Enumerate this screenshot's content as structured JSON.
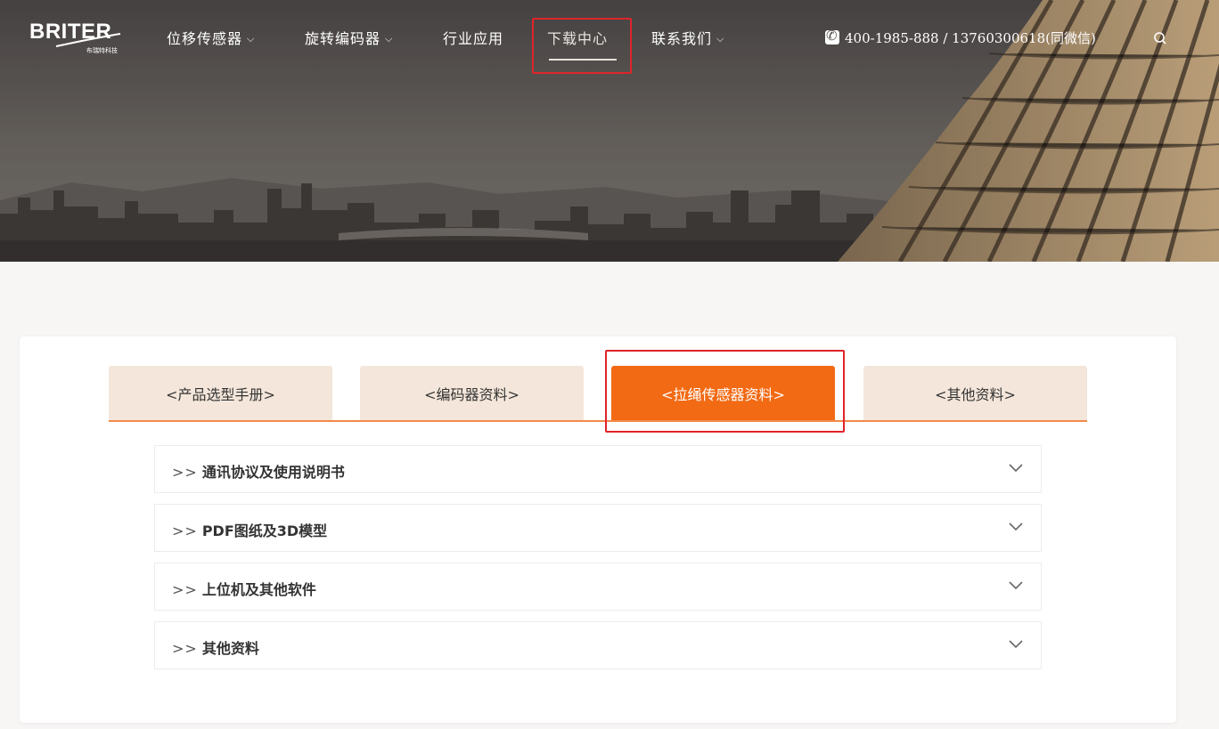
{
  "brand": {
    "logo_text": "BRITER",
    "logo_subtitle": "布瑞特科技"
  },
  "nav": {
    "items": [
      {
        "label": "位移传感器",
        "has_dropdown": true
      },
      {
        "label": "旋转编码器",
        "has_dropdown": true
      },
      {
        "label": "行业应用",
        "has_dropdown": false
      },
      {
        "label": "下载中心",
        "has_dropdown": false,
        "active": true
      },
      {
        "label": "联系我们",
        "has_dropdown": true
      }
    ],
    "dropdown_glyph": "⌵",
    "phone": "400-1985-888 / 13760300618(同微信)",
    "phone_icon": "phone-icon",
    "search_icon": "search-icon"
  },
  "tabs": [
    {
      "label": "<产品选型手册>"
    },
    {
      "label": "<编码器资料>"
    },
    {
      "label": "<拉绳传感器资料>",
      "active": true
    },
    {
      "label": "<其他资料>"
    }
  ],
  "accordion": {
    "prefix": ">>",
    "items": [
      {
        "label": "通讯协议及使用说明书"
      },
      {
        "label": "PDF图纸及3D模型"
      },
      {
        "label": "上位机及其他软件"
      },
      {
        "label": "其他资料"
      }
    ],
    "chevron_icon": "chevron-down-icon"
  },
  "colors": {
    "accent": "#f26a14",
    "tab_bg": "#f4e6da",
    "highlight_box": "#e0242a"
  }
}
